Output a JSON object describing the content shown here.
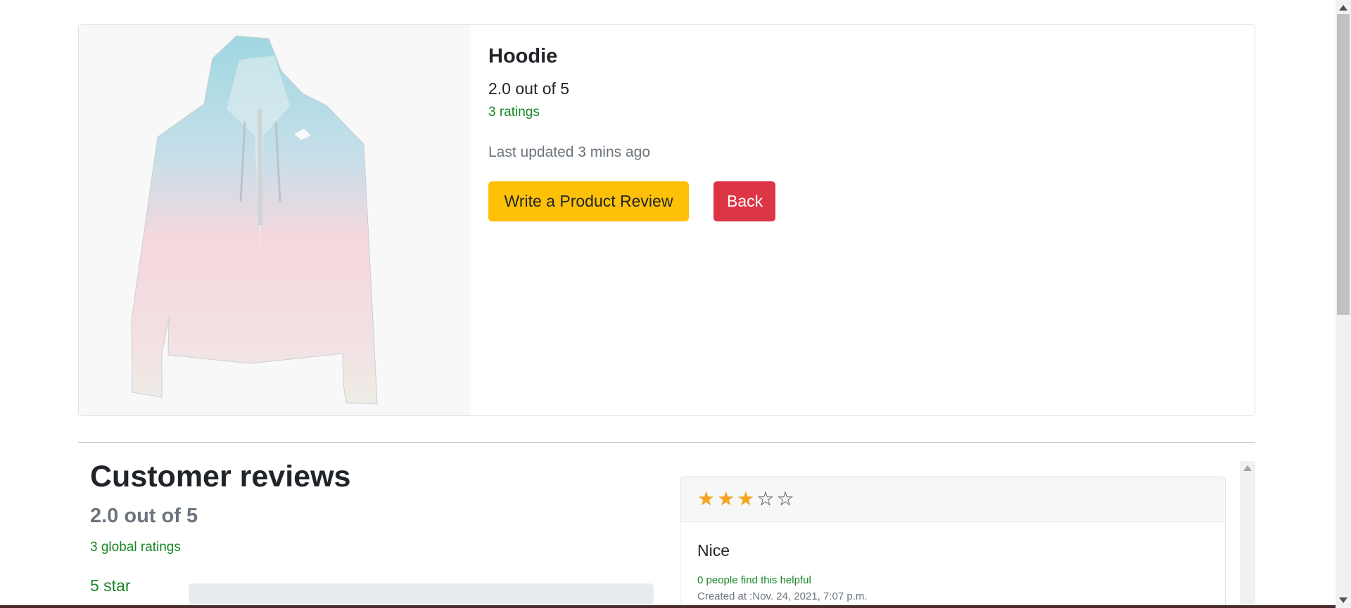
{
  "product": {
    "title": "Hoodie",
    "rating_text": "2.0 out of 5",
    "ratings_count": "3 ratings",
    "last_updated": "Last updated 3 mins ago",
    "write_review_label": "Write a Product Review",
    "back_label": "Back",
    "image_icon": "hoodie-product-image"
  },
  "reviews_summary": {
    "heading": "Customer reviews",
    "average": "2.0 out of 5",
    "global_ratings": "3 global ratings",
    "star_rows": [
      {
        "label": "5 star",
        "fraction": 0
      }
    ]
  },
  "reviews": [
    {
      "stars": 3,
      "max_stars": 5,
      "title": "Nice",
      "helpful": "0 people find this helpful",
      "created": "Created at :Nov. 24, 2021, 7:07 p.m."
    }
  ],
  "colors": {
    "accent_yellow": "#ffc107",
    "danger_red": "#dc3545",
    "success_green": "#198727",
    "star_orange": "#f5a31a",
    "muted_gray": "#6c757d"
  }
}
